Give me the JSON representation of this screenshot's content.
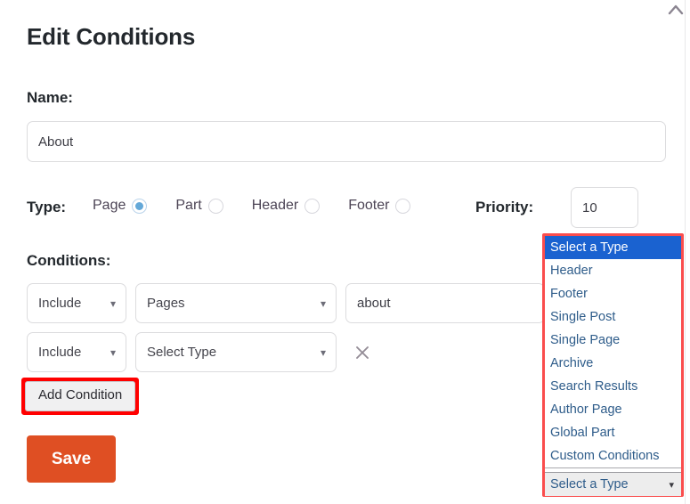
{
  "window": {
    "collapse_icon": "chevron-up-icon"
  },
  "header": {
    "title": "Edit Conditions"
  },
  "form": {
    "name_label": "Name:",
    "name_value": "About",
    "type_label": "Type:",
    "type_options": [
      {
        "label": "Page",
        "selected": true
      },
      {
        "label": "Part",
        "selected": false
      },
      {
        "label": "Header",
        "selected": false
      },
      {
        "label": "Footer",
        "selected": false
      }
    ],
    "priority_label": "Priority:",
    "priority_value": "10",
    "conditions_label": "Conditions:",
    "rows": [
      {
        "mode": "Include",
        "source": "Pages",
        "value": "about",
        "has_remove": false
      },
      {
        "mode": "Include",
        "source": "Select Type",
        "value": "",
        "has_remove": true,
        "remove_icon": "close-x-icon"
      }
    ],
    "add_condition_label": "Add Condition",
    "save_label": "Save"
  },
  "dropdown": {
    "closed_value": "Select a Type",
    "caret_icon": "chevron-down-icon",
    "options": [
      {
        "label": "Select a Type",
        "selected": true
      },
      {
        "label": "Header",
        "selected": false
      },
      {
        "label": "Footer",
        "selected": false
      },
      {
        "label": "Single Post",
        "selected": false
      },
      {
        "label": "Single Page",
        "selected": false
      },
      {
        "label": "Archive",
        "selected": false
      },
      {
        "label": "Search Results",
        "selected": false
      },
      {
        "label": "Author Page",
        "selected": false
      },
      {
        "label": "Global Part",
        "selected": false
      },
      {
        "label": "Custom Conditions",
        "selected": false
      }
    ]
  },
  "colors": {
    "highlight_blue": "#1a62d0",
    "option_text": "#2e5c8a",
    "save_orange": "#df4f23",
    "annotation_red": "#ff0000",
    "dropdown_outline_red": "#fa4d4d",
    "radio_selected": "#63a8d8"
  }
}
